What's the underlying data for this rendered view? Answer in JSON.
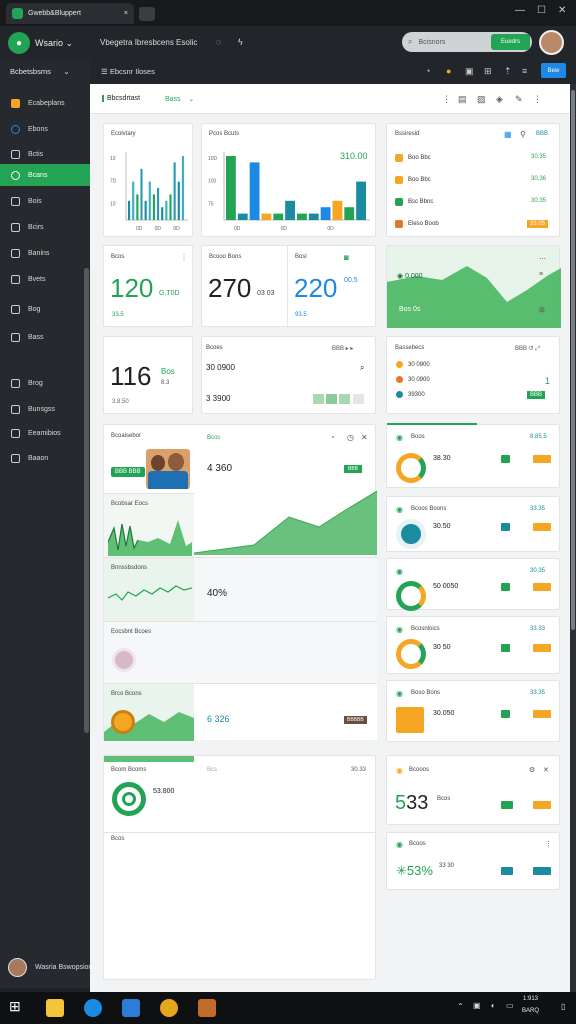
{
  "browser": {
    "tab_title": "Gwebb&Bluppert",
    "close_glyph": "×",
    "window_controls": [
      "—",
      "☐",
      "✕"
    ]
  },
  "header": {
    "app_name": "Wsario",
    "nav_text": "Vbegetra Ibresbcens Esolic",
    "search_placeholder": "Bcisnors",
    "search_button": "Euedrs"
  },
  "sidebar": {
    "title": "Bcbetsbsms",
    "items": [
      {
        "label": "Ecabeplans",
        "icon": "dashboard-icon",
        "active": false
      },
      {
        "label": "Ebons",
        "icon": "drop-icon",
        "active": false
      },
      {
        "label": "Bctis",
        "icon": "chart-icon",
        "active": false
      },
      {
        "label": "Bcans",
        "icon": "user-icon",
        "active": true
      },
      {
        "label": "Bois",
        "icon": "box-icon",
        "active": false
      },
      {
        "label": "Bcirs",
        "icon": "grid-icon",
        "active": false
      },
      {
        "label": "Banins",
        "icon": "card-icon",
        "active": false
      },
      {
        "label": "Bvets",
        "icon": "gear-icon",
        "active": false
      },
      {
        "label": "Bog",
        "icon": "target-icon",
        "active": false
      },
      {
        "label": "Bass",
        "icon": "file-icon",
        "active": false
      },
      {
        "label": "Brog",
        "icon": "list-icon",
        "active": false
      },
      {
        "label": "Bunsgss",
        "icon": "doc-icon",
        "active": false
      },
      {
        "label": "Eeamibios",
        "icon": "clock-icon",
        "active": false
      },
      {
        "label": "Baaon",
        "icon": "person-icon",
        "active": false
      }
    ],
    "user_name": "Wasria Bswopsions"
  },
  "toolbar": {
    "breadcrumb": "Ebcsnr Iloses",
    "new_button": "Bew"
  },
  "subbar": {
    "title": "Bbcsdrtast",
    "badge": "Bass"
  },
  "cards": {
    "c1": {
      "title": "Ecolvtary",
      "y_ticks": [
        "10",
        "7D",
        "10"
      ],
      "x_ticks": [
        "0D",
        "0D",
        "0D"
      ],
      "bars": [
        3,
        6,
        4,
        8,
        3,
        6,
        4,
        5,
        2,
        3,
        4,
        9,
        6,
        10
      ]
    },
    "c2": {
      "title": "Pcos Bcuts",
      "y_ticks": [
        "10D",
        "100",
        "75"
      ],
      "x_ticks": [
        "0D",
        "0D",
        "0D"
      ],
      "value": "310.00",
      "bars": [
        10,
        1,
        9,
        1,
        1,
        3,
        1,
        1,
        2,
        3,
        2,
        6
      ]
    },
    "c3": {
      "title": "Bssiresid",
      "rows": [
        {
          "label": "Boo Bbc",
          "value": "30.35"
        },
        {
          "label": "Boo Bbc",
          "value": "30.36"
        },
        {
          "label": "Bsc Bbnc",
          "value": "30.35"
        },
        {
          "label": "Eleso Boob",
          "value": "33.05"
        }
      ]
    },
    "k1": {
      "label": "Bcos",
      "value": "120",
      "sub": "G.T0D",
      "foot": "33.5"
    },
    "k2": {
      "label": "Bcooo Bons",
      "value": "270",
      "sub": "03 03"
    },
    "k3": {
      "label": "Bosl",
      "value": "220",
      "sub": "00.5",
      "foot": "93.5"
    },
    "k4": {
      "label": "0.000",
      "sub": "Bos 0s"
    },
    "r3c1": {
      "value": "116",
      "tag": "Bos",
      "sub": "8.3",
      "foot": "3.8.50"
    },
    "r3c2": {
      "title": "Bcoes",
      "row1": "30 0900",
      "row2": "3 3900"
    },
    "r3c3": {
      "title": "Bassebecs",
      "rows": [
        {
          "label": "30 0900",
          "value": ""
        },
        {
          "label": "30 0900",
          "value": "1"
        },
        {
          "label": "39300",
          "value": "BBB"
        }
      ]
    },
    "lp": {
      "title": "Bcoaisebor",
      "badge": "BBB BBB",
      "right_title": "Bcos",
      "right_value": "4 360",
      "right_badge": "BBB"
    },
    "lp2": {
      "title": "Bcobsar Eocs"
    },
    "lp3": {
      "title": "Bnnssbsdons",
      "percent": "40%"
    },
    "lp4": {
      "title": "Eocsbnt Bcoes"
    },
    "lp5": {
      "title": "Brco Bcons",
      "value": "6 326",
      "badge": "BBBBB"
    },
    "rp": [
      {
        "title": "Boos",
        "value": "8.85.5",
        "sub": "38.30"
      },
      {
        "title": "Bcoos Boons",
        "value": "33.35",
        "sub": "30.50"
      },
      {
        "title": "",
        "value": "30.35",
        "sub": "50 0050"
      },
      {
        "title": "Bcosnloics",
        "value": "33.33",
        "sub": "30 50"
      },
      {
        "title": "Boso Bons",
        "value": "33.35",
        "sub": "30.050"
      }
    ],
    "b1": {
      "title": "Bcom Bcoms",
      "value": "Bcs",
      "right": "30.33",
      "sub": "53.800"
    },
    "b2": {
      "title": "Bcooos",
      "value": "533",
      "sub": "Bcos"
    },
    "b3": {
      "title": "Bcoos",
      "value": "53%",
      "sub": "33 30"
    },
    "b4": {
      "title": "Bcos"
    }
  },
  "taskbar": {
    "time": "1:913",
    "date": "BARQ"
  },
  "colors": {
    "green": "#23a455",
    "blue": "#1e88e5",
    "orange": "#f5a623",
    "teal": "#1b8ba0"
  }
}
